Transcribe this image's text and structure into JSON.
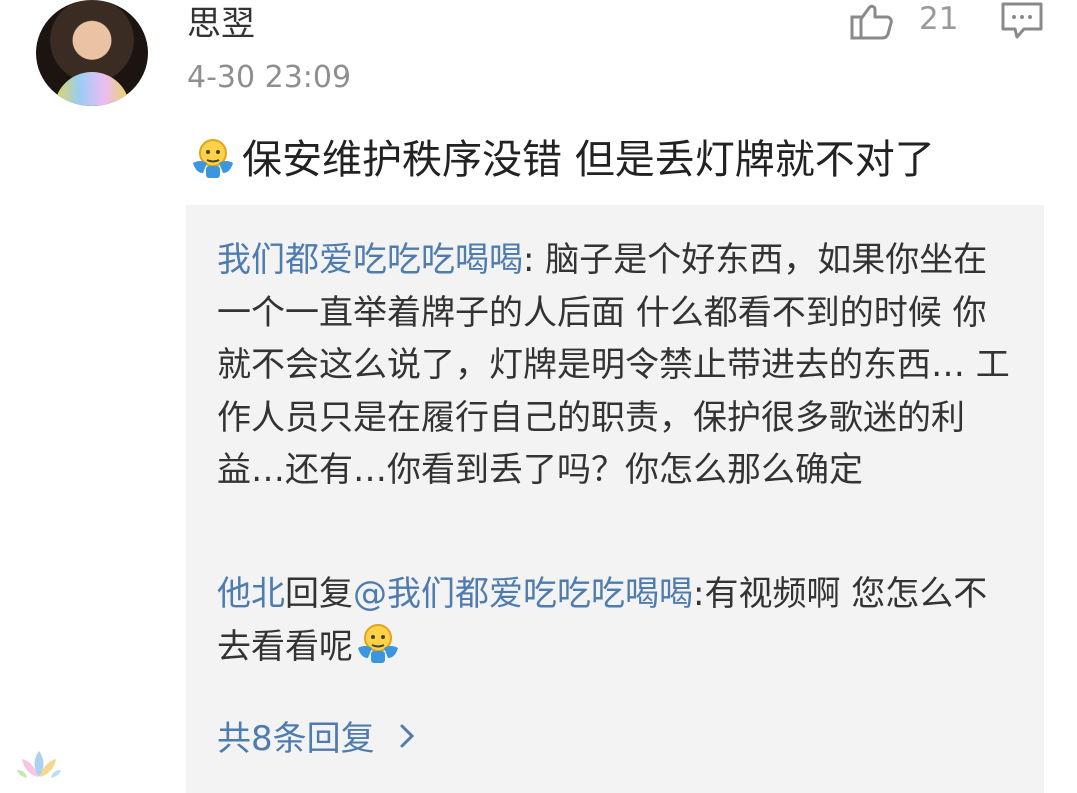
{
  "comment": {
    "username": "思翌",
    "timestamp": "4-30 23:09",
    "like_count": "21",
    "text": "保安维护秩序没错 但是丢灯牌就不对了",
    "icons": [
      "thumbs-up-icon",
      "comment-icon",
      "shrug-emoji-icon"
    ]
  },
  "replies": [
    {
      "name": "我们都爱吃吃吃喝喝",
      "separator": ":",
      "text": " 脑子是个好东西，如果你坐在一个一直举着牌子的人后面 什么都看不到的时候  你就不会这么说了，灯牌是明令禁止带进去的东西… 工作人员只是在履行自己的职责，保护很多歌迷的利益…还有…你看到丢了吗？你怎么那么确定"
    },
    {
      "name": "他北",
      "reply_word": "回复",
      "mention": "@我们都爱吃吃吃喝喝",
      "separator": ":",
      "text": "有视频啊 您怎么不去看看呢"
    }
  ],
  "more_replies_label": "共8条回复",
  "colors": {
    "link": "#4f7cae",
    "reply_bg": "#f3f3f3",
    "muted": "#8f8f8f"
  }
}
